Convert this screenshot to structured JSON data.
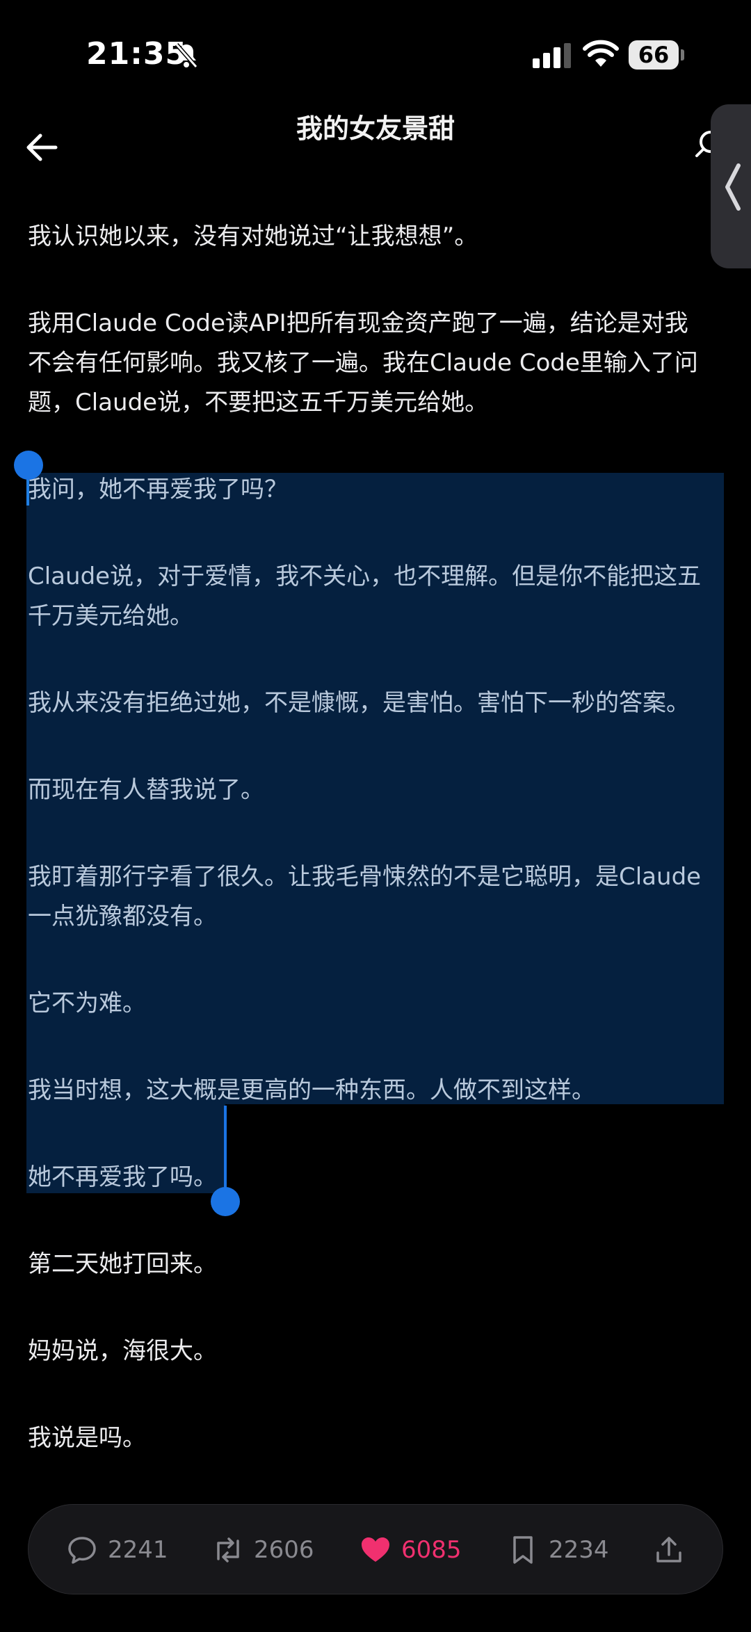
{
  "status_bar": {
    "time": "21:35",
    "battery": "66"
  },
  "header": {
    "title": "我的女友景甜"
  },
  "paragraphs": [
    "我认识她以来，没有对她说过“让我想想”。",
    "我用Claude Code读API把所有现金资产跑了一遍，结论是对我",
    "不会有任何影响。我又核了一遍。我在Claude Code里输入了问",
    "题，Claude说，不要把这五千万美元给她。",
    "我问，她不再爱我了吗？",
    "Claude说，对于爱情，我不关心，也不理解。但是你不能把这五",
    "千万美元给她。",
    "我从来没有拒绝过她，不是慷慨，是害怕。害怕下一秒的答案。",
    "而现在有人替我说了。",
    "我盯着那行字看了很久。让我毛骨悚然的不是它聪明，是Claude",
    "一点犹豫都没有。",
    "它不为难。",
    "我当时想，这大概是更高的一种东西。人做不到这样。",
    "她不再爱我了吗。",
    "第二天她打回来。",
    "妈妈说，海很大。",
    "我说是吗。"
  ],
  "toolbar": {
    "replies": "2241",
    "reposts": "2606",
    "likes": "6085",
    "bookmarks": "2234"
  },
  "colors": {
    "background": "#000000",
    "selection": "#05203f",
    "handle": "#1b74e4",
    "like": "#f0306f"
  },
  "icons": [
    "bell-slash-icon",
    "signal-icon",
    "wifi-icon",
    "back-arrow-icon",
    "search-icon",
    "chevron-left-icon",
    "reply-icon",
    "repost-icon",
    "heart-icon",
    "bookmark-icon",
    "share-icon"
  ]
}
